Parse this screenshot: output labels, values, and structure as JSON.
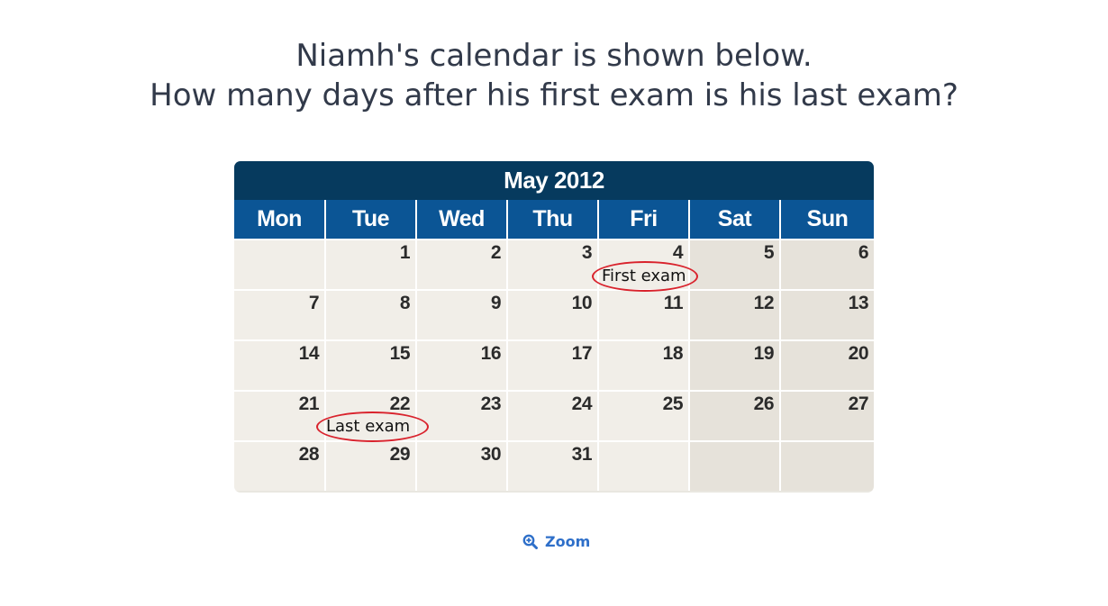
{
  "question": {
    "line1": "Niamh's calendar is shown below.",
    "line2": "How many days after his first exam is his last exam?"
  },
  "calendar": {
    "title": "May 2012",
    "weekdays": [
      "Mon",
      "Tue",
      "Wed",
      "Thu",
      "Fri",
      "Sat",
      "Sun"
    ],
    "weeks": [
      [
        "",
        "1",
        "2",
        "3",
        "4",
        "5",
        "6"
      ],
      [
        "7",
        "8",
        "9",
        "10",
        "11",
        "12",
        "13"
      ],
      [
        "14",
        "15",
        "16",
        "17",
        "18",
        "19",
        "20"
      ],
      [
        "21",
        "22",
        "23",
        "24",
        "25",
        "26",
        "27"
      ],
      [
        "28",
        "29",
        "30",
        "31",
        "",
        "",
        ""
      ]
    ],
    "annotations": {
      "first_exam": "First exam",
      "last_exam": "Last exam"
    },
    "colors": {
      "title_bg": "#063a5e",
      "weekday_bg": "#0b5595",
      "weekday_cell": "#f1eee8",
      "weekend_cell": "#e6e2da",
      "annotation_ring": "#d9232d"
    }
  },
  "zoom": {
    "label": "Zoom",
    "icon": "zoom-in-icon",
    "color": "#2e6fc9"
  }
}
